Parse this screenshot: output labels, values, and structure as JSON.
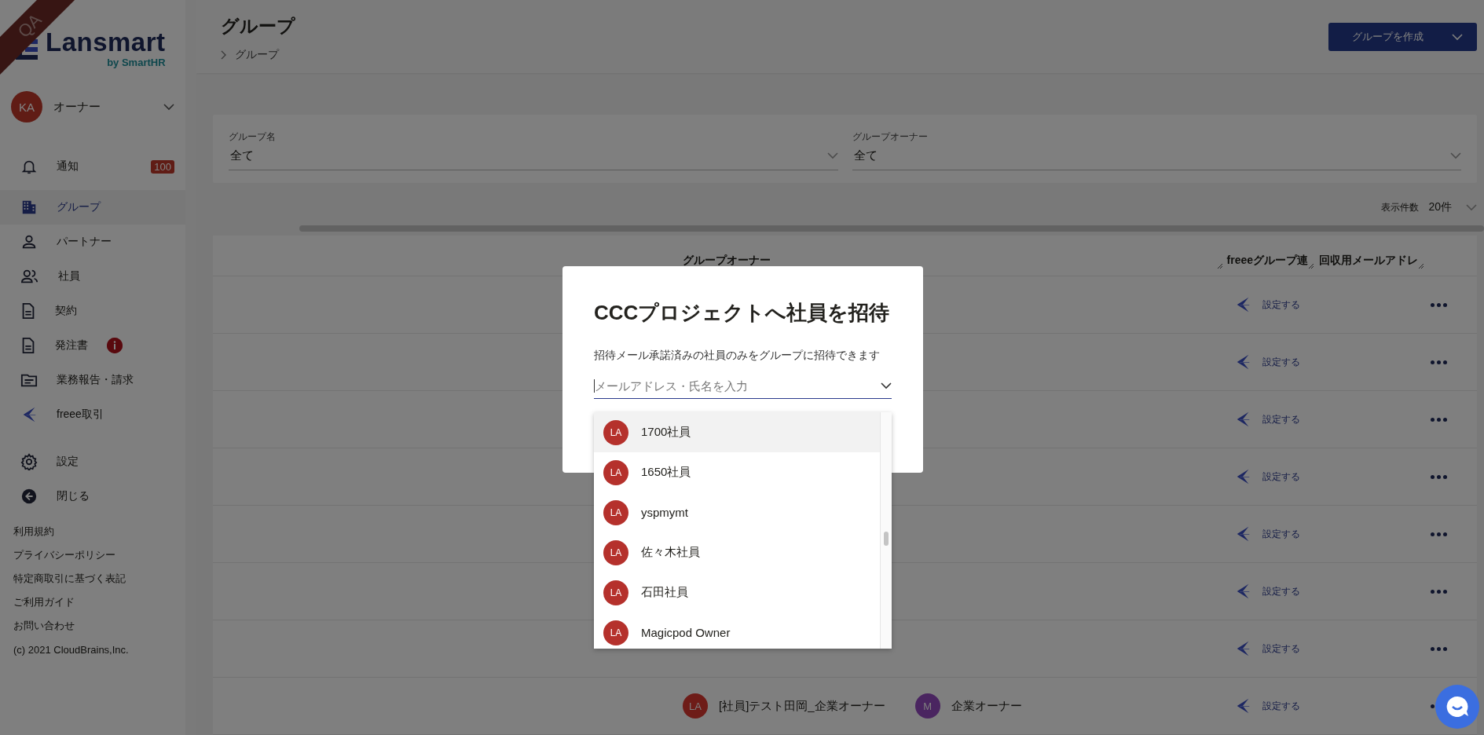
{
  "ribbon": "QA",
  "logo": {
    "name": "Lansmart",
    "by": "by SmartHR"
  },
  "account": {
    "initials": "KA",
    "role": "オーナー"
  },
  "nav": [
    {
      "label": "通知",
      "badge": "100",
      "selected": false
    },
    {
      "label": "グループ",
      "selected": true
    },
    {
      "label": "パートナー",
      "selected": false
    },
    {
      "label": "社員",
      "selected": false
    },
    {
      "label": "契約",
      "selected": false
    },
    {
      "label": "発注書",
      "alert": true,
      "selected": false
    },
    {
      "label": "業務報告・請求",
      "selected": false
    },
    {
      "label": "freee取引",
      "selected": false
    }
  ],
  "nav_bottom": [
    {
      "label": "設定",
      "selected": false
    },
    {
      "label": "閉じる",
      "selected": false
    }
  ],
  "footer_links": [
    "利用規約",
    "プライバシーポリシー",
    "特定商取引に基づく表記",
    "ご利用ガイド",
    "お問い合わせ"
  ],
  "copyright": "(c) 2021 CloudBrains,Inc.",
  "header": {
    "title": "グループ",
    "breadcrumb": "グループ",
    "create_button": "グループを作成"
  },
  "filters": [
    {
      "label": "グループ名",
      "value": "全て"
    },
    {
      "label": "グループオーナー",
      "value": "全て"
    }
  ],
  "page_size": {
    "label": "表示件数",
    "value": "20件"
  },
  "table": {
    "columns": [
      "グループオーナー",
      "freeeグループ連",
      "回収用メールアドレ"
    ],
    "rows": [
      {
        "link": "設定する"
      },
      {
        "link": "設定する"
      },
      {
        "link": "設定する"
      },
      {
        "link": "設定する"
      },
      {
        "link": "設定する"
      },
      {
        "link": "設定する"
      },
      {
        "link": "設定する"
      },
      {
        "link": "設定する",
        "owners": [
          {
            "initials": "LA",
            "name": "[社員]テスト田岡_企業オーナー",
            "color": "#6e1c18"
          },
          {
            "initials": "M",
            "name": "企業オーナー",
            "color": "#4a2560"
          }
        ]
      }
    ]
  },
  "modal": {
    "title": "CCCプロジェクトへ社員を招待",
    "description": "招待メール承諾済みの社員のみをグループに招待できます",
    "field": {
      "placeholder": "メールアドレス・氏名を入力"
    },
    "options": [
      {
        "initials": "LA",
        "name": "1700社員",
        "selected": true
      },
      {
        "initials": "LA",
        "name": "1650社員",
        "selected": false
      },
      {
        "initials": "LA",
        "name": "yspmymt",
        "selected": false
      },
      {
        "initials": "LA",
        "name": "佐々木社員",
        "selected": false
      },
      {
        "initials": "LA",
        "name": "石田社員",
        "selected": false
      },
      {
        "initials": "LA",
        "name": "Magicpod Owner",
        "selected": false
      }
    ]
  }
}
